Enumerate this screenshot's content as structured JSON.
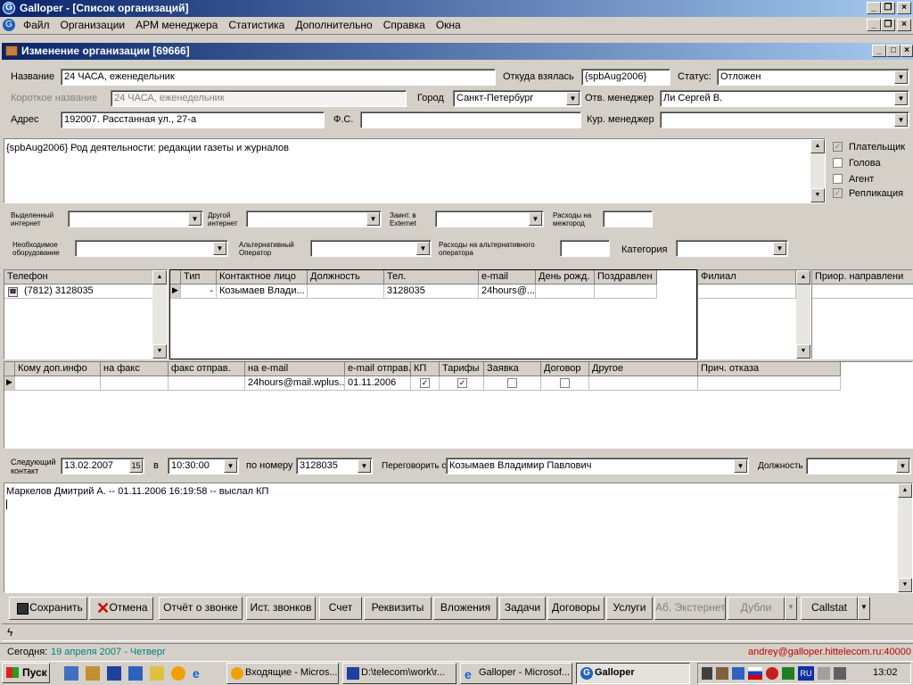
{
  "app": {
    "title": "Galloper - [Список организаций]"
  },
  "menu": [
    "Файл",
    "Организации",
    "АРМ менеджера",
    "Статистика",
    "Дополнительно",
    "Справка",
    "Окна"
  ],
  "dialog": {
    "title": "Изменение организации [69666]"
  },
  "form": {
    "name_label": "Название",
    "name_value": "24 ЧАСА, еженедельник",
    "origin_label": "Откуда взялась",
    "origin_value": "{spbAug2006}",
    "status_label": "Статус:",
    "status_value": "Отложен",
    "short_label": "Короткое название",
    "short_value": "24 ЧАСА, еженедельник",
    "city_label": "Город",
    "city_value": "Санкт-Петербург",
    "resp_label": "Отв. менеджер",
    "resp_value": "Ли Сергей В.",
    "addr_label": "Адрес",
    "addr_value": "192007. Расстанная ул., 27-а",
    "fs_label": "Ф.С.",
    "fs_value": "",
    "cur_label": "Кур. менеджер",
    "cur_value": ""
  },
  "note": "{spbAug2006}   Род деятельности: редакции газеты и журналов",
  "flags": [
    {
      "label": "Плательщик",
      "checked": true,
      "disabled": true
    },
    {
      "label": "Голова",
      "checked": false,
      "disabled": false
    },
    {
      "label": "Агент",
      "checked": false,
      "disabled": false
    },
    {
      "label": "Репликация",
      "checked": true,
      "disabled": true
    }
  ],
  "extra": {
    "inet_label": "Выделенный интернет",
    "other_inet_label": "Другой интернет",
    "extnet_label": "Заинт. в Externet",
    "costs_label": "Расходы на межгород",
    "equip_label": "Необходимое оборудование",
    "alt_op_label": "Альтернативный Оператор",
    "alt_costs_label": "Расходы на альтернативного оператора",
    "category_label": "Категория"
  },
  "phones": {
    "header": "Телефон",
    "rows": [
      "(7812) 3128035"
    ]
  },
  "contacts": {
    "headers": [
      "Тип",
      "Контактное лицо",
      "Должность",
      "Тел.",
      "e-mail",
      "День рожд.",
      "Поздравлен"
    ],
    "rows": [
      [
        "-",
        "Козымаев Влади...",
        "",
        "3128035",
        "24hours@...",
        "",
        ""
      ]
    ]
  },
  "branch": {
    "header": "Филиал"
  },
  "prio": {
    "header": "Приор. направлени"
  },
  "mail": {
    "headers": [
      "Кому доп.инфо",
      "на факс",
      "факс отправ.",
      "на e-mail",
      "e-mail отправ.",
      "КП",
      "Тарифы",
      "Заявка",
      "Договор",
      "Другое",
      "Прич. отказа"
    ],
    "rows": [
      {
        "email": "24hours@mail.wplus...",
        "sent": "01.11.2006",
        "kp": true,
        "tarify": true,
        "zayavka": false,
        "dogovor": false
      }
    ]
  },
  "next": {
    "label": "Следующий контакт",
    "date": "13.02.2007",
    "cal": "15",
    "at": "в",
    "time": "10:30:00",
    "num_label": "по номеру",
    "num": "3128035",
    "talk_label": "Переговорить с",
    "talk": "Козымаев Владимир Павлович",
    "pos_label": "Должность",
    "pos": ""
  },
  "log": "Маркелов Дмитрий А. -- 01.11.2006 16:19:58 -- выслал КП",
  "buttons": {
    "save": "Сохранить",
    "cancel": "Отмена",
    "report": "Отчёт о звонке",
    "history": "Ист. звонков",
    "bill": "Счет",
    "requisites": "Реквизиты",
    "attach": "Вложения",
    "tasks": "Задачи",
    "contracts": "Договоры",
    "services": "Услуги",
    "extern": "Аб. Экстернет",
    "dupes": "Дубли",
    "callstat": "Callstat"
  },
  "status": {
    "today_label": "Сегодня:",
    "today": "19 апреля 2007 - Четверг",
    "user": "andrey@galloper.hittelecom.ru:40000"
  },
  "taskbar": {
    "start": "Пуск",
    "tasks": [
      "Входящие - Micros...",
      "D:\\telecom\\work\\r...",
      "Galloper - Microsof...",
      "Galloper"
    ],
    "lang": "RU",
    "clock": "13:02"
  }
}
